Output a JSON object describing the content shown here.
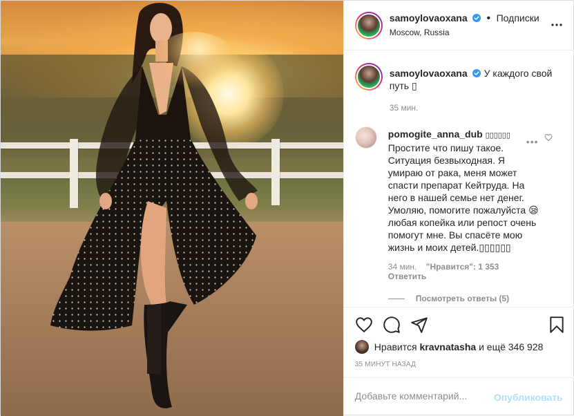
{
  "header": {
    "username": "samoylovaoxana",
    "follow_dot": "•",
    "follow_label": "Подписки",
    "location": "Moscow, Russia"
  },
  "caption": {
    "username": "samoylovaoxana",
    "text": "У каждого свой путь ▯",
    "time": "35 мин."
  },
  "comment": {
    "username": "pomogite_anna_dub",
    "username_suffix": "▯▯▯▯▯▯",
    "text": "Простите что пишу такое. Ситуация безвыходная. Я умираю от рака, меня может спасти препарат Кейтруда. На него в нашей семье нет денег. Умоляю, помогите пожалуйста 😪 любая копейка или репост очень помогут мне. Вы спасёте мою жизнь и моих детей.▯▯▯▯▯▯",
    "more": "•••",
    "time": "34 мин.",
    "likes": "\"Нравится\": 1 353",
    "reply": "Ответить",
    "view_replies": "Посмотреть ответы (5)"
  },
  "likes_row": {
    "prefix": "Нравится",
    "user": "kravnatasha",
    "suffix": "и ещё 346 928"
  },
  "post_date": "35 МИНУТ НАЗАД",
  "add_comment": {
    "placeholder": "Добавьте комментарий...",
    "publish": "Опубликовать"
  },
  "colors": {
    "verified": "#3897f0",
    "publish_disabled": "#b2dffc",
    "meta_gray": "#8e8e8e"
  },
  "icons": [
    "verified-icon",
    "more-options-icon",
    "heart-icon",
    "comment-icon",
    "share-icon",
    "bookmark-icon"
  ]
}
